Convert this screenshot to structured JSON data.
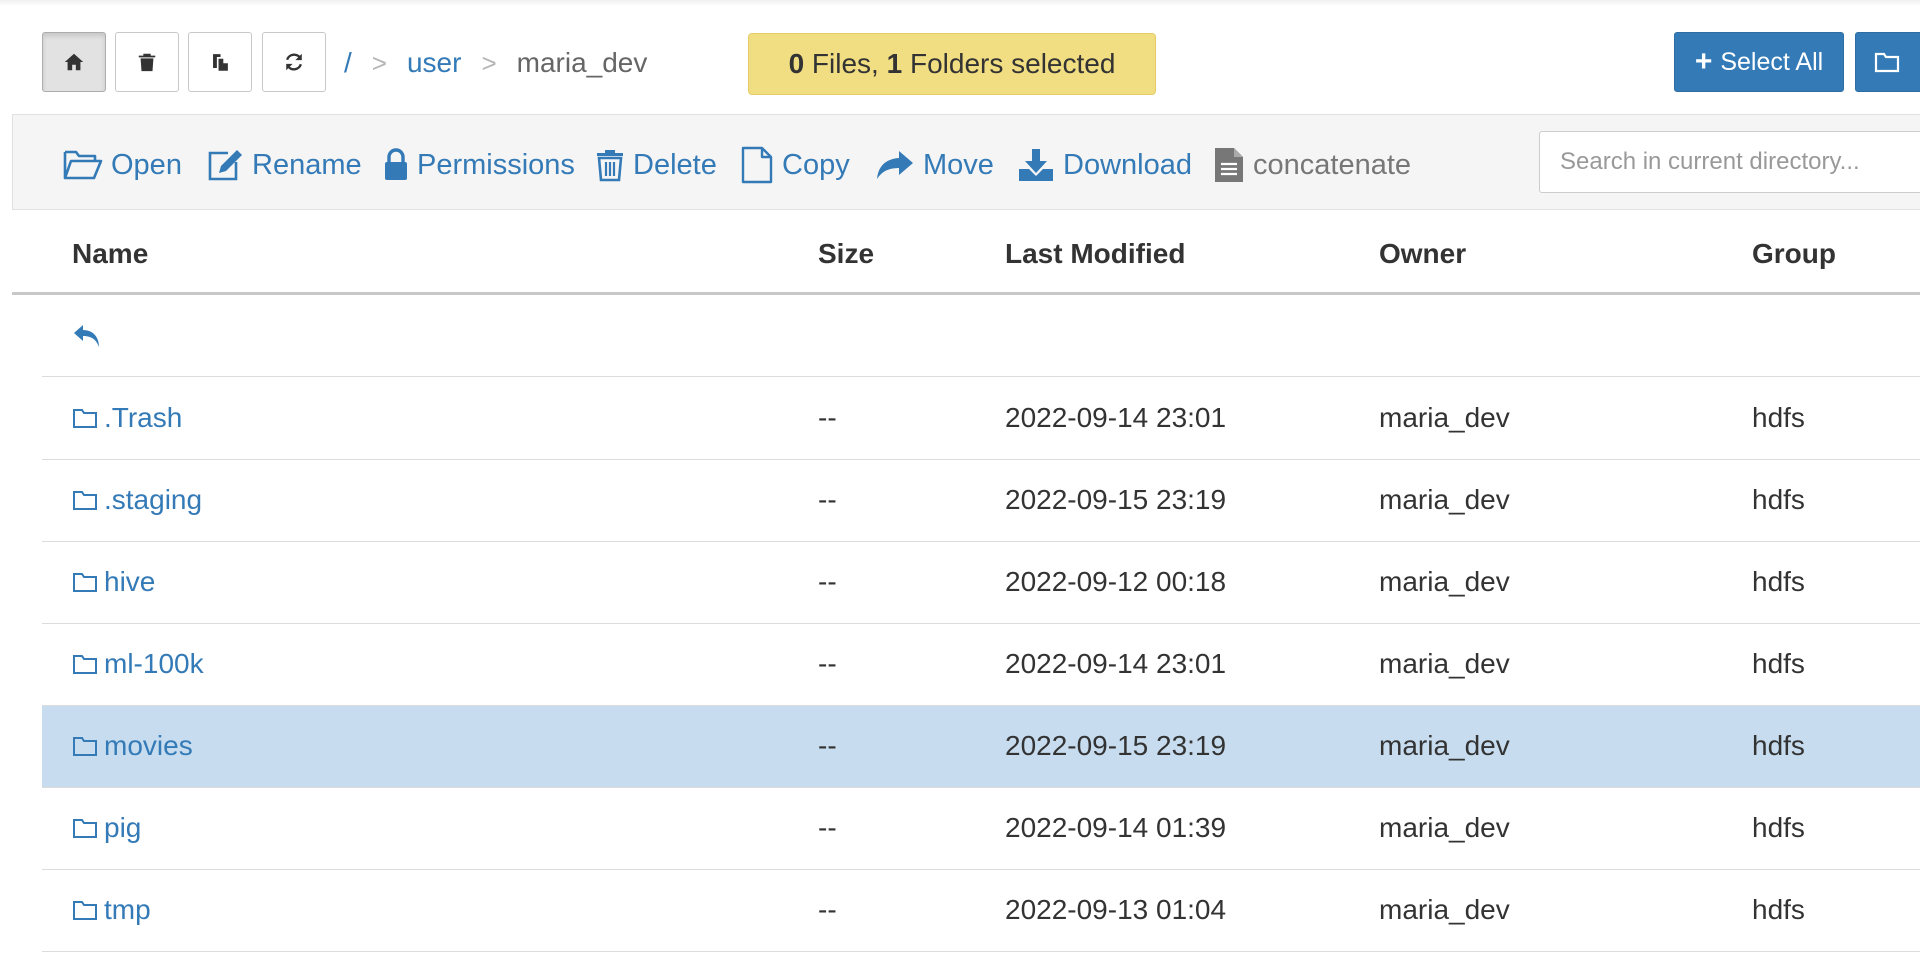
{
  "toolbar_top": {
    "home_icon": "home-icon",
    "trash_icon": "trash-icon",
    "paste_icon": "paste-icon",
    "refresh_icon": "refresh-icon"
  },
  "breadcrumb": {
    "root": "/",
    "sep1": ">",
    "level1": "user",
    "sep2": ">",
    "current": "maria_dev"
  },
  "selection": {
    "files_count": "0",
    "files_label": " Files, ",
    "folders_count": "1",
    "folders_label": " Folders selected"
  },
  "actions": {
    "select_all_icon": "+",
    "select_all": "Select All",
    "open": "Open",
    "rename": "Rename",
    "permissions": "Permissions",
    "delete": "Delete",
    "copy": "Copy",
    "move": "Move",
    "download": "Download",
    "concatenate": "concatenate"
  },
  "search": {
    "placeholder": "Search in current directory..."
  },
  "table": {
    "columns": [
      "Name",
      "Size",
      "Last Modified",
      "Owner",
      "Group"
    ],
    "rows": [
      {
        "name": ".Trash",
        "size": "--",
        "modified": "2022-09-14 23:01",
        "owner": "maria_dev",
        "group": "hdfs",
        "selected": false
      },
      {
        "name": ".staging",
        "size": "--",
        "modified": "2022-09-15 23:19",
        "owner": "maria_dev",
        "group": "hdfs",
        "selected": false
      },
      {
        "name": "hive",
        "size": "--",
        "modified": "2022-09-12 00:18",
        "owner": "maria_dev",
        "group": "hdfs",
        "selected": false
      },
      {
        "name": "ml-100k",
        "size": "--",
        "modified": "2022-09-14 23:01",
        "owner": "maria_dev",
        "group": "hdfs",
        "selected": false
      },
      {
        "name": "movies",
        "size": "--",
        "modified": "2022-09-15 23:19",
        "owner": "maria_dev",
        "group": "hdfs",
        "selected": true
      },
      {
        "name": "pig",
        "size": "--",
        "modified": "2022-09-14 01:39",
        "owner": "maria_dev",
        "group": "hdfs",
        "selected": false
      },
      {
        "name": "tmp",
        "size": "--",
        "modified": "2022-09-13 01:04",
        "owner": "maria_dev",
        "group": "hdfs",
        "selected": false
      }
    ]
  },
  "colors": {
    "link": "#337ab7",
    "selected_row": "#c7ddef",
    "selection_badge": "#f1dd82",
    "primary_button": "#337ab7"
  }
}
